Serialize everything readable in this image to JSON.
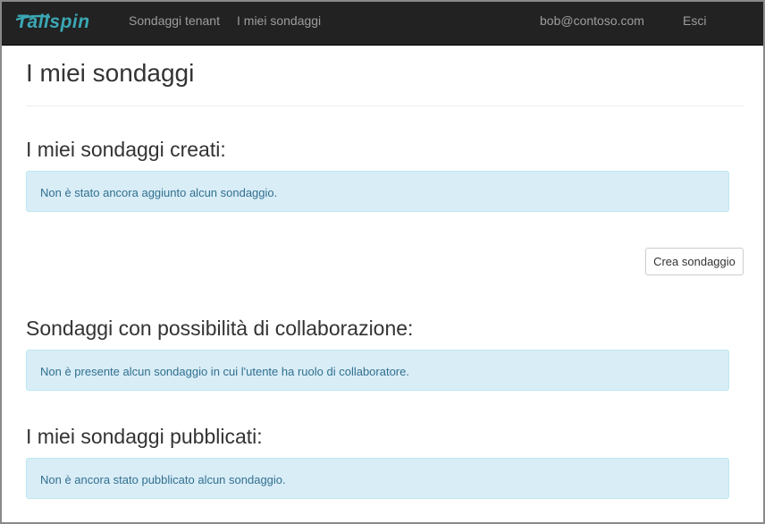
{
  "nav": {
    "brand": "Tailspin",
    "links": [
      "Sondaggi tenant",
      "I miei sondaggi"
    ],
    "user": "bob@contoso.com",
    "logout": "Esci"
  },
  "page": {
    "title": "I miei sondaggi"
  },
  "sections": {
    "created": {
      "title": "I miei sondaggi creati:",
      "message": "Non è stato ancora aggiunto alcun sondaggio.",
      "button": "Crea sondaggio"
    },
    "collaboration": {
      "title": "Sondaggi con possibilità di collaborazione:",
      "message": "Non è presente alcun sondaggio in cui l'utente ha ruolo di collaboratore."
    },
    "published": {
      "title": "I miei sondaggi pubblicati:",
      "message": "Non è ancora stato pubblicato alcun sondaggio."
    }
  },
  "colors": {
    "navbar": "#222222",
    "brand": "#3ba7b4",
    "alert_bg": "#d9edf7",
    "alert_text": "#31708f"
  }
}
